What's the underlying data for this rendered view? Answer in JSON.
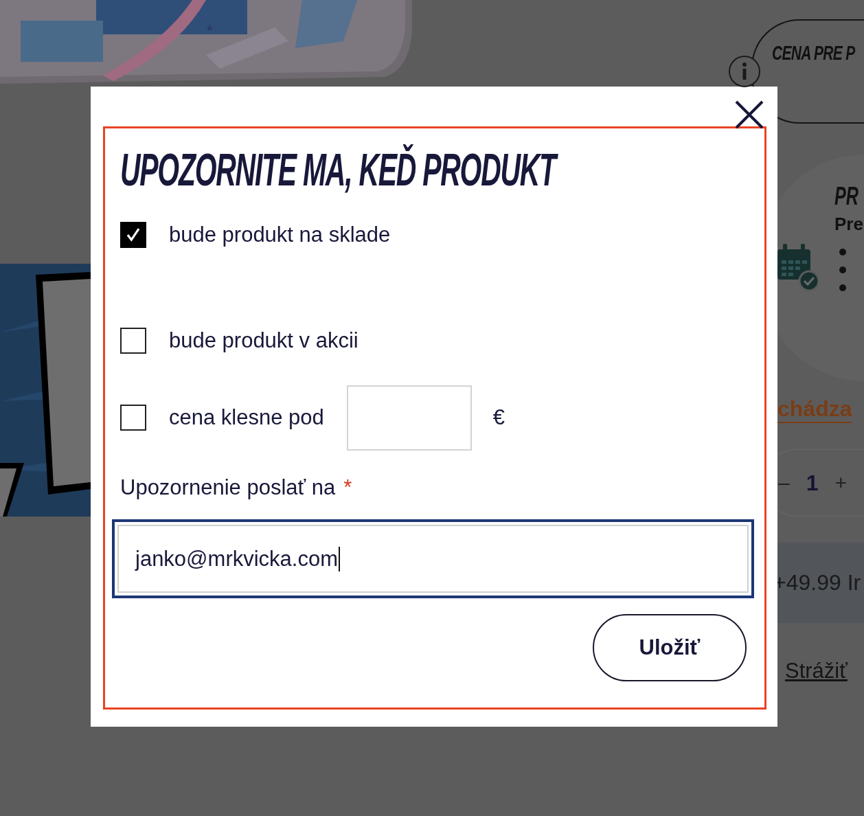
{
  "background": {
    "price_badge": "CENA PRE P",
    "info_heading": "PR",
    "info_subheading": "Pre",
    "link": "chádza",
    "quantity": {
      "minus": "–",
      "value": "1",
      "plus": "+"
    },
    "price_bar": "+49.99 Ir",
    "watch_link": "Strážiť"
  },
  "dialog": {
    "title": "UPOZORNITE MA, KEĎ PRODUKT",
    "options": [
      {
        "kind": "checkbox",
        "label": "bude produkt na sklade",
        "checked": true
      },
      {
        "kind": "checkbox",
        "label": "bude produkt v akcii",
        "checked": false
      },
      {
        "kind": "price",
        "label": "cena klesne pod",
        "checked": false,
        "currency": "€"
      }
    ],
    "email": {
      "label": "Upozornenie poslať na",
      "required_mark": "*",
      "value": "janko@mrkvicka.com",
      "focused": true
    },
    "submit": "Uložiť"
  }
}
